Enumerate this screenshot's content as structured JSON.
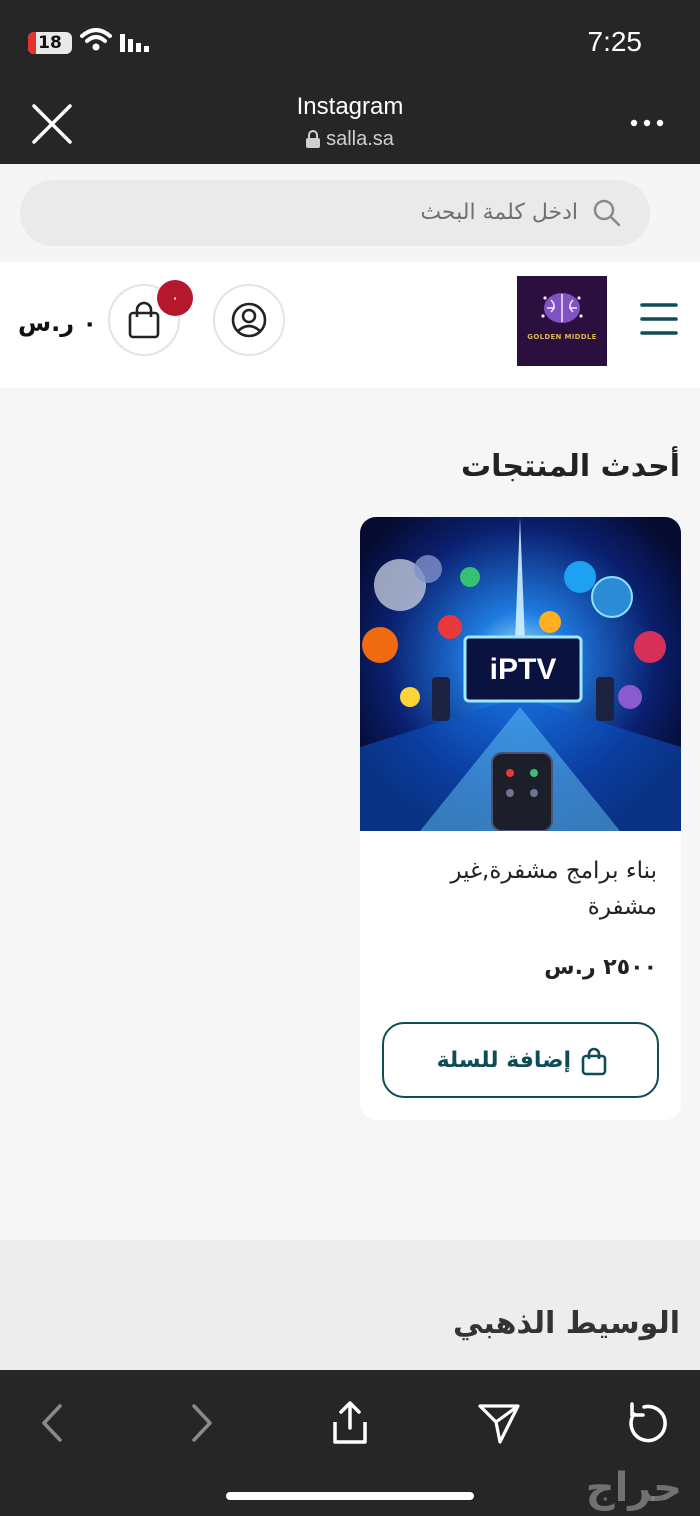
{
  "status": {
    "battery": "18",
    "battery_level": 0.18,
    "time": "7:25"
  },
  "browser": {
    "title": "Instagram",
    "url": "salla.sa"
  },
  "search": {
    "placeholder": "ادخل كلمة البحث"
  },
  "header": {
    "logo_text": "GOLDEN MIDDLE",
    "cart_count": "٠",
    "cart_total": "٠ ر.س"
  },
  "latest": {
    "title": "أحدث المنتجات"
  },
  "product": {
    "image_text": "iPTV",
    "name": "بناء برامج مشفرة,غير مشفرة",
    "price": "٢٥٠٠ ر.س",
    "add_to_cart": "إضافة للسلة"
  },
  "footer": {
    "title": "الوسيط الذهبي"
  },
  "watermark": "حراج",
  "colors": {
    "accent": "#0f4c55",
    "badge": "#b5172d",
    "dark_bar": "#262626"
  }
}
